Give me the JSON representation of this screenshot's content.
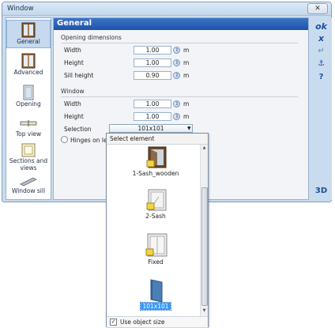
{
  "window": {
    "title": "Window",
    "close_glyph": "✕"
  },
  "panel": {
    "title": "General"
  },
  "nav": {
    "items": [
      {
        "label": "General",
        "icon": "window-sash-icon",
        "selected": true
      },
      {
        "label": "Advanced",
        "icon": "window-advanced-icon",
        "selected": false
      },
      {
        "label": "Opening",
        "icon": "opening-icon",
        "selected": false
      },
      {
        "label": "Top view",
        "icon": "top-view-icon",
        "selected": false
      },
      {
        "label": "Sections and views",
        "icon": "sections-icon",
        "selected": false
      },
      {
        "label": "Window sill",
        "icon": "window-sill-icon",
        "selected": false
      }
    ]
  },
  "opening": {
    "title": "Opening dimensions",
    "width": {
      "label": "Width",
      "value": "1.00",
      "unit": "m"
    },
    "height": {
      "label": "Height",
      "value": "1.00",
      "unit": "m"
    },
    "sill": {
      "label": "Sill height",
      "value": "0.90",
      "unit": "m"
    }
  },
  "window_group": {
    "title": "Window",
    "width": {
      "label": "Width",
      "value": "1.00",
      "unit": "m"
    },
    "height": {
      "label": "Height",
      "value": "1.00",
      "unit": "m"
    },
    "selection": {
      "label": "Selection",
      "value": "101x101"
    },
    "hinges_label": "Hinges on left"
  },
  "actions": {
    "ok": "ok",
    "cancel": "x",
    "enter": "↵",
    "anchor": "⚓",
    "help": "?",
    "view3d": "3D"
  },
  "popup": {
    "header": "Select element",
    "items": [
      {
        "label": "1-Sash_wooden",
        "selected": false
      },
      {
        "label": "2-Sash",
        "selected": false
      },
      {
        "label": "Fixed",
        "selected": false
      },
      {
        "label": "101x101",
        "selected": true
      }
    ],
    "footer": {
      "checkbox_label": "Use object size",
      "checked": true
    }
  },
  "colors": {
    "accent": "#1e52a9",
    "window_bg": "#c9dcef",
    "selection": "#3399ff"
  }
}
